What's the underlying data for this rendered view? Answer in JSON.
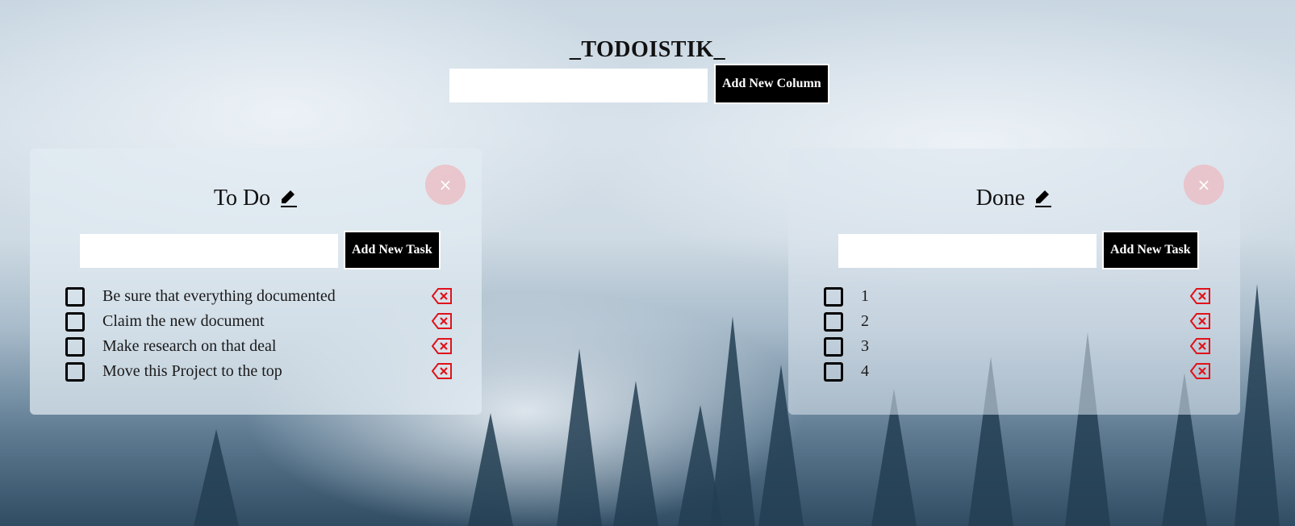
{
  "app": {
    "title": "_TODOISTIK_",
    "new_column_input": {
      "value": "",
      "placeholder": ""
    },
    "add_column_label": "Add New Column"
  },
  "colors": {
    "button_bg": "#000000",
    "button_text": "#ffffff",
    "close_bg": "#ecbac0",
    "delete_icon": "#e0121a"
  },
  "icons": {
    "edit": "pencil-icon",
    "delete": "backspace-x-icon",
    "close": "close-icon"
  },
  "columns": [
    {
      "title": "To Do",
      "close_label": "×",
      "new_task_input": {
        "value": "",
        "placeholder": ""
      },
      "add_task_label": "Add New Task",
      "tasks": [
        {
          "text": "Be sure that everything documented",
          "done": false
        },
        {
          "text": "Claim the new document",
          "done": false
        },
        {
          "text": "Make research on that deal",
          "done": false
        },
        {
          "text": "Move this Project to the top",
          "done": false
        }
      ]
    },
    {
      "title": "Done",
      "close_label": "×",
      "new_task_input": {
        "value": "",
        "placeholder": ""
      },
      "add_task_label": "Add New Task",
      "tasks": [
        {
          "text": "1",
          "done": false
        },
        {
          "text": "2",
          "done": false
        },
        {
          "text": "3",
          "done": false
        },
        {
          "text": "4",
          "done": false
        }
      ]
    }
  ]
}
